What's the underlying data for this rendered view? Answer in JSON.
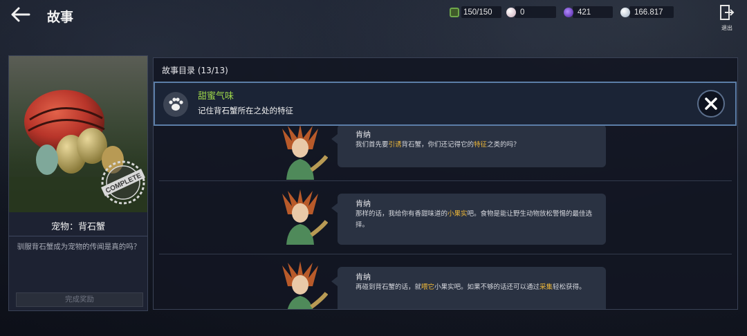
{
  "header": {
    "title": "故事",
    "currencies": [
      {
        "icon": "energy-icon",
        "value": "150/150",
        "color": "#6fa84a"
      },
      {
        "icon": "pearl-icon",
        "value": "0",
        "color": "#d9c8d0"
      },
      {
        "icon": "crystal-icon",
        "value": "421",
        "color": "#7a4ad9"
      },
      {
        "icon": "silver-icon",
        "value": "166.817",
        "color": "#c9d6e4"
      }
    ],
    "exit_label": "退出"
  },
  "pet_card": {
    "badge_text": "COMPLETE",
    "name": "宠物：背石蟹",
    "description": "驯服背石蟹成为宠物的传闻是真的吗？",
    "reward_button": "完成奖励"
  },
  "story": {
    "header": "故事目录 (13/13)",
    "active_quest": {
      "title": "甜蜜气味",
      "description": "记住背石蟹所在之处的特征",
      "icon": "paw-icon"
    },
    "dialogs": [
      {
        "speaker": "肯纳",
        "parts": [
          {
            "text": "我们首先要",
            "hl": false
          },
          {
            "text": "引诱",
            "hl": true
          },
          {
            "text": "背石蟹，你们还记得它的",
            "hl": false
          },
          {
            "text": "特征",
            "hl": true
          },
          {
            "text": "之类的吗？",
            "hl": false
          }
        ]
      },
      {
        "speaker": "肯纳",
        "parts": [
          {
            "text": "那样的话，我给你有香甜味道的",
            "hl": false
          },
          {
            "text": "小果实",
            "hl": true
          },
          {
            "text": "吧。食物是能让野生动物放松警惕的最佳选择。",
            "hl": false
          }
        ]
      },
      {
        "speaker": "肯纳",
        "parts": [
          {
            "text": "再碰到背石蟹的话，就",
            "hl": false
          },
          {
            "text": "喂它",
            "hl": true
          },
          {
            "text": "小果实吧。如果不够的话还可以通过",
            "hl": false
          },
          {
            "text": "采集",
            "hl": true
          },
          {
            "text": "轻松获得。",
            "hl": false
          }
        ]
      }
    ]
  },
  "colors": {
    "highlight": "#f0b93a",
    "quest_title": "#9fd84a",
    "accent_border": "#5c7ea8"
  }
}
